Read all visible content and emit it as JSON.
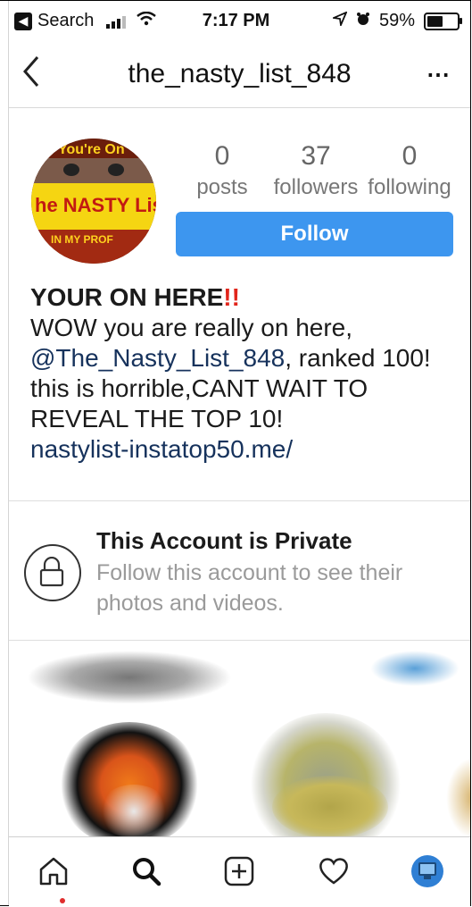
{
  "status_bar": {
    "back_app": "Search",
    "time": "7:17 PM",
    "battery": "59%",
    "battery_level": 0.59
  },
  "nav": {
    "back_icon": "chevron-left-icon",
    "username": "the_nasty_list_848",
    "more_icon": "more-horizontal-icon"
  },
  "profile": {
    "avatar_text_top": "You're On",
    "avatar_text_band": "he NASTY Lis",
    "avatar_text_bottom": "IN MY PROF",
    "stats": [
      {
        "value": "0",
        "label": "posts"
      },
      {
        "value": "37",
        "label": "followers"
      },
      {
        "value": "0",
        "label": "following"
      }
    ],
    "follow_label": "Follow",
    "follow_color": "#3d96ef"
  },
  "bio": {
    "name": "YOUR ON HERE",
    "name_emoji": "!!",
    "line1": "WOW you are really on here,",
    "mention": "@The_Nasty_List_848",
    "line2_rest": ",  ranked 100!",
    "line3": "this is horrible,CANT WAIT TO",
    "line4": "REVEAL THE TOP 10!",
    "url": "nastylist-instatop50.me/"
  },
  "private": {
    "icon": "lock-icon",
    "title": "This Account is Private",
    "subtitle": "Follow this account to see their photos and videos."
  },
  "tabbar": {
    "items": [
      "home-icon",
      "search-icon",
      "add-post-icon",
      "heart-icon",
      "profile-avatar-icon"
    ]
  }
}
